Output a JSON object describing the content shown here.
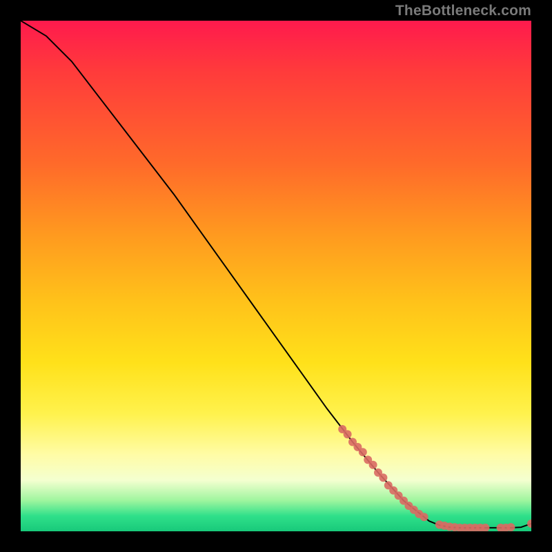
{
  "watermark": "TheBottleneck.com",
  "chart_data": {
    "type": "line",
    "title": "",
    "xlabel": "",
    "ylabel": "",
    "xlim": [
      0,
      100
    ],
    "ylim": [
      0,
      100
    ],
    "grid": false,
    "legend": null,
    "series": [
      {
        "name": "curve",
        "style": "line",
        "color": "#000000",
        "x": [
          0,
          5,
          10,
          15,
          20,
          25,
          30,
          35,
          40,
          45,
          50,
          55,
          60,
          65,
          70,
          75,
          80,
          82,
          84,
          86,
          88,
          90,
          92,
          94,
          96,
          98,
          100
        ],
        "y": [
          100,
          97,
          92,
          85.5,
          79,
          72.5,
          66,
          59,
          52,
          45,
          38,
          31,
          24,
          17.5,
          11.5,
          6,
          2,
          1.2,
          0.8,
          0.7,
          0.7,
          0.7,
          0.7,
          0.7,
          0.7,
          0.8,
          1.5
        ]
      },
      {
        "name": "markers",
        "style": "scatter",
        "color": "#d96a63",
        "x": [
          63,
          64,
          65,
          66,
          67,
          68,
          69,
          70,
          71,
          72,
          73,
          74,
          75,
          76,
          77,
          78,
          79,
          82,
          83,
          84,
          85,
          86,
          87,
          88,
          89,
          90,
          91,
          94,
          95,
          96,
          100
        ],
        "y": [
          20,
          19,
          17.5,
          16.5,
          15.5,
          14,
          13,
          11.5,
          10.5,
          9,
          8,
          7,
          6,
          5,
          4.2,
          3.4,
          2.8,
          1.3,
          1.1,
          0.9,
          0.8,
          0.7,
          0.7,
          0.7,
          0.7,
          0.7,
          0.7,
          0.7,
          0.7,
          0.8,
          1.5
        ]
      }
    ]
  }
}
